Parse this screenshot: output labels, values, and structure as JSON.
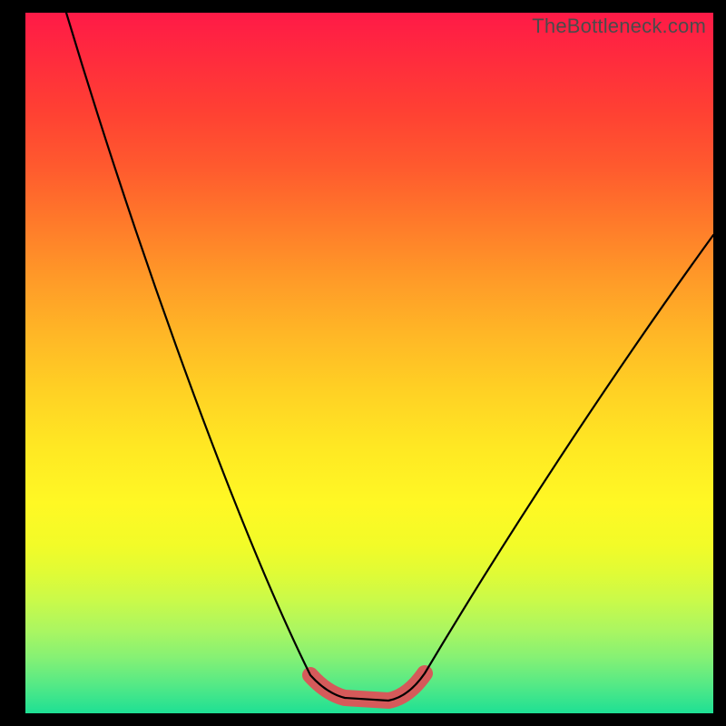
{
  "watermark": "TheBottleneck.com",
  "colors": {
    "curve": "#000000",
    "floor_highlight": "#d55a5a",
    "background": "#000000"
  },
  "chart_data": {
    "type": "line",
    "title": "",
    "xlabel": "",
    "ylabel": "",
    "xlim": [
      0,
      100
    ],
    "ylim": [
      0,
      100
    ],
    "series": [
      {
        "name": "bottleneck-curve",
        "x": [
          0,
          5,
          10,
          15,
          20,
          25,
          30,
          35,
          40,
          43,
          46,
          49,
          52,
          55,
          60,
          65,
          70,
          75,
          80,
          85,
          90,
          95,
          100
        ],
        "values": [
          100,
          90,
          79,
          68,
          57,
          46,
          35,
          24,
          13,
          7,
          3,
          1,
          1,
          3,
          10,
          18,
          26,
          34,
          42,
          49,
          56,
          62,
          68
        ]
      },
      {
        "name": "optimal-flat-region",
        "x": [
          43,
          46,
          49,
          52,
          55
        ],
        "values": [
          2,
          1,
          1,
          1,
          2
        ]
      }
    ],
    "notes": "V-shaped bottleneck curve on rainbow heat gradient; valley ≈ x 47–55 highlighted in red; curve starts top-left, dips to near-zero, rises to ≈68% at right edge."
  }
}
